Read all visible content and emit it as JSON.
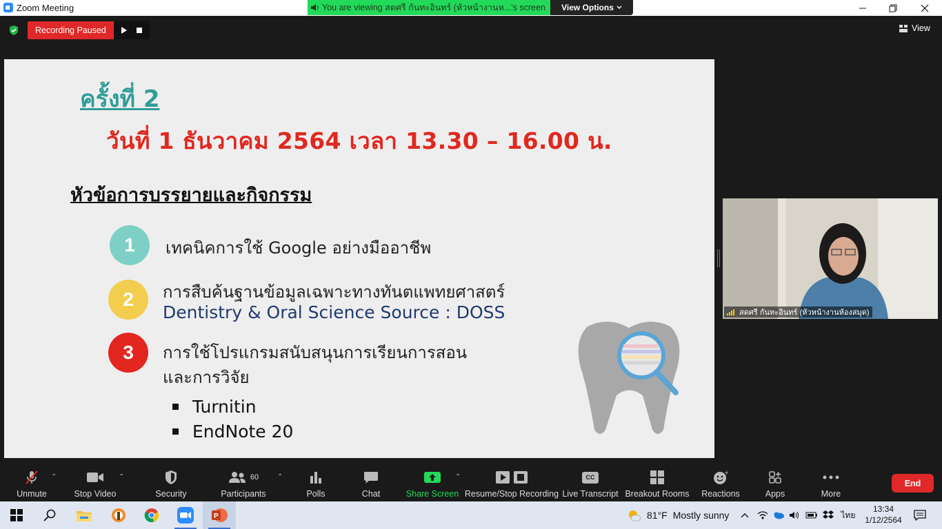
{
  "window": {
    "title": "Zoom Meeting",
    "viewing_banner": "You are viewing สดศรี กันทะอินทร์ (หัวหน้างานห...'s screen",
    "view_options": "View Options",
    "view_label": "View"
  },
  "recording": {
    "status": "Recording Paused"
  },
  "slide": {
    "session": "ครั้งที่ 2",
    "date": "วันที่ 1 ธันวาคม 2564 เวลา 13.30 – 16.00 น.",
    "topics_heading": "หัวข้อการบรรยายและกิจกรรม",
    "items": [
      {
        "num": "1",
        "line1": "เทคนิคการใช้ Google อย่างมืออาชีพ",
        "line2": ""
      },
      {
        "num": "2",
        "line1": "การสืบค้นฐานข้อมูลเฉพาะทางทันตแพทยศาสตร์",
        "line2": "Dentistry & Oral Science Source : DOSS"
      },
      {
        "num": "3",
        "line1": "การใช้โปรแกรมสนับสนุนการเรียนการสอน",
        "line2": "และการวิจัย"
      }
    ],
    "bullets": [
      "Turnitin",
      "EndNote 20"
    ]
  },
  "participant": {
    "name": "สดศรี กันทะอินทร์ (หัวหน้างานห้องสมุด)"
  },
  "toolbar": {
    "unmute": "Unmute",
    "stop_video": "Stop Video",
    "security": "Security",
    "participants": "Participants",
    "participants_count": "60",
    "polls": "Polls",
    "chat": "Chat",
    "share_screen": "Share Screen",
    "resume_stop_recording": "Resume/Stop Recording",
    "live_transcript": "Live Transcript",
    "breakout_rooms": "Breakout Rooms",
    "reactions": "Reactions",
    "apps": "Apps",
    "more": "More",
    "end": "End",
    "cc": "CC",
    "accent_green": "#23d959",
    "end_color": "#e02828"
  },
  "taskbar": {
    "temperature": "81°F",
    "weather": "Mostly sunny",
    "language": "ไทย",
    "time": "13:34",
    "date": "1/12/2564"
  }
}
